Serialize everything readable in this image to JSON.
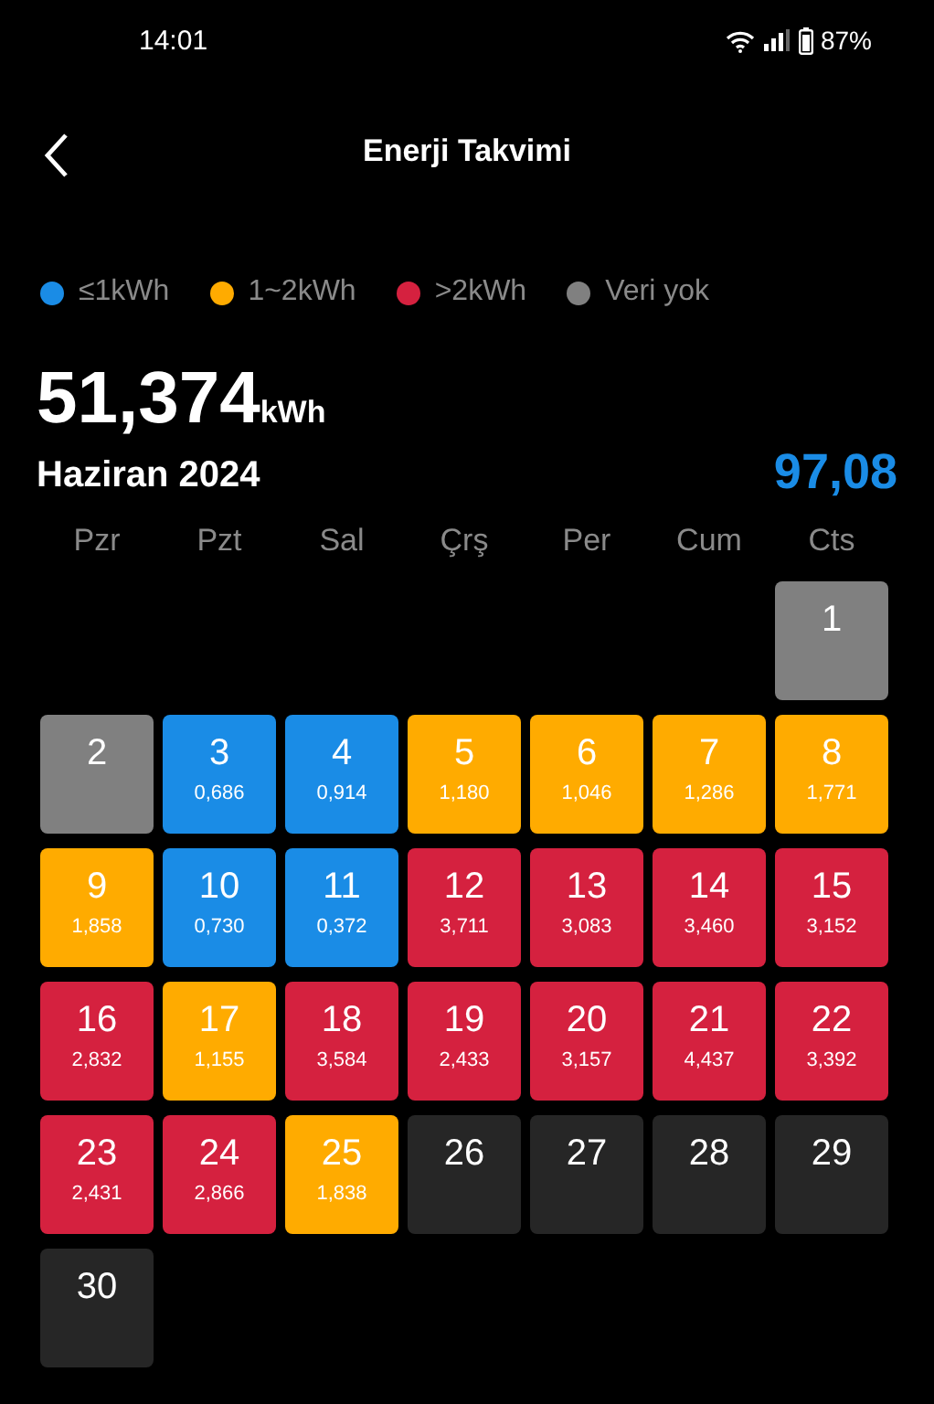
{
  "status_bar": {
    "time": "14:01",
    "battery": "87%"
  },
  "header": {
    "title": "Enerji Takvimi"
  },
  "legend": [
    {
      "label": "≤1kWh",
      "color": "#1a8ce6"
    },
    {
      "label": "1~2kWh",
      "color": "#ffab00"
    },
    {
      "label": ">2kWh",
      "color": "#d5213f"
    },
    {
      "label": "Veri yok",
      "color": "#808080"
    }
  ],
  "total": {
    "value": "51,374",
    "unit": "kWh"
  },
  "month": "Haziran 2024",
  "score": "97,08",
  "weekdays": [
    "Pzr",
    "Pzt",
    "Sal",
    "Çrş",
    "Per",
    "Cum",
    "Cts"
  ],
  "weeks": [
    [
      {
        "day": "1",
        "kind": "none"
      }
    ],
    [
      {
        "day": "2",
        "kind": "none"
      },
      {
        "day": "3",
        "value": "0,686",
        "kind": "low"
      },
      {
        "day": "4",
        "value": "0,914",
        "kind": "low"
      },
      {
        "day": "5",
        "value": "1,180",
        "kind": "mid"
      },
      {
        "day": "6",
        "value": "1,046",
        "kind": "mid"
      },
      {
        "day": "7",
        "value": "1,286",
        "kind": "mid"
      },
      {
        "day": "8",
        "value": "1,771",
        "kind": "mid"
      }
    ],
    [
      {
        "day": "9",
        "value": "1,858",
        "kind": "mid"
      },
      {
        "day": "10",
        "value": "0,730",
        "kind": "low"
      },
      {
        "day": "11",
        "value": "0,372",
        "kind": "low"
      },
      {
        "day": "12",
        "value": "3,711",
        "kind": "high"
      },
      {
        "day": "13",
        "value": "3,083",
        "kind": "high"
      },
      {
        "day": "14",
        "value": "3,460",
        "kind": "high"
      },
      {
        "day": "15",
        "value": "3,152",
        "kind": "high"
      }
    ],
    [
      {
        "day": "16",
        "value": "2,832",
        "kind": "high"
      },
      {
        "day": "17",
        "value": "1,155",
        "kind": "mid"
      },
      {
        "day": "18",
        "value": "3,584",
        "kind": "high"
      },
      {
        "day": "19",
        "value": "2,433",
        "kind": "high"
      },
      {
        "day": "20",
        "value": "3,157",
        "kind": "high"
      },
      {
        "day": "21",
        "value": "4,437",
        "kind": "high"
      },
      {
        "day": "22",
        "value": "3,392",
        "kind": "high"
      }
    ],
    [
      {
        "day": "23",
        "value": "2,431",
        "kind": "high"
      },
      {
        "day": "24",
        "value": "2,866",
        "kind": "high"
      },
      {
        "day": "25",
        "value": "1,838",
        "kind": "mid"
      },
      {
        "day": "26",
        "kind": "future"
      },
      {
        "day": "27",
        "kind": "future"
      },
      {
        "day": "28",
        "kind": "future"
      },
      {
        "day": "29",
        "kind": "future"
      }
    ],
    [
      {
        "day": "30",
        "kind": "future"
      }
    ]
  ]
}
